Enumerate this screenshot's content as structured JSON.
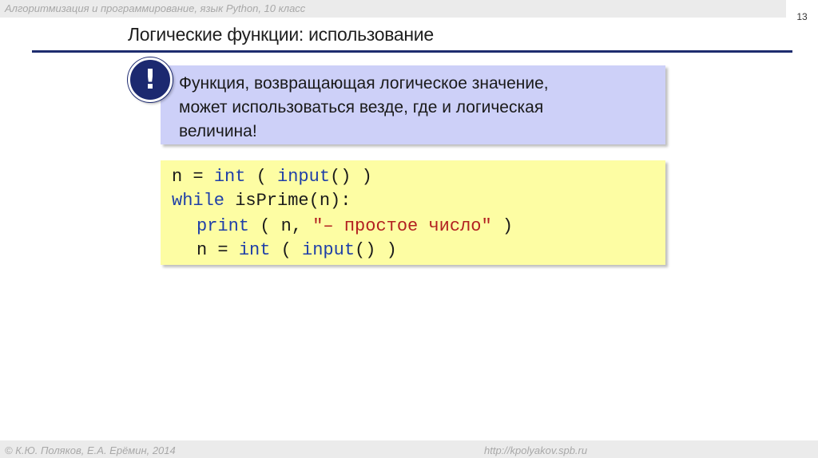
{
  "header": {
    "course_title": "Алгоритмизация и программирование, язык Python, 10 класс",
    "page_number": "13"
  },
  "slide": {
    "title": "Логические функции: использование"
  },
  "note": {
    "icon": "exclamation-icon",
    "lines": [
      "Функция, возвращающая логическое значение,",
      "может использоваться везде, где и логическая",
      "величина!"
    ]
  },
  "code": {
    "line1": {
      "var": "n",
      "assign": " = ",
      "func1": "int",
      "open": " ( ",
      "func2": "input",
      "close": "() )"
    },
    "line2": {
      "keyword": "while",
      "rest": " isPrime(n):"
    },
    "line3": {
      "func": "print",
      "open": " ( n, ",
      "string": "\"– простое число\"",
      "close": " )"
    },
    "line4": {
      "var": "n",
      "assign": " = ",
      "func1": "int",
      "open": " ( ",
      "func2": "input",
      "close": "() )"
    }
  },
  "footer": {
    "copyright": "© К.Ю. Поляков, Е.А. Ерёмин, 2014",
    "url": "http://kpolyakov.spb.ru"
  },
  "colors": {
    "title_rule": "#1e2c6e",
    "note_background": "#cdd0f8",
    "code_background": "#fdfda3",
    "keyword": "#1f3fa8",
    "string": "#b22020"
  }
}
